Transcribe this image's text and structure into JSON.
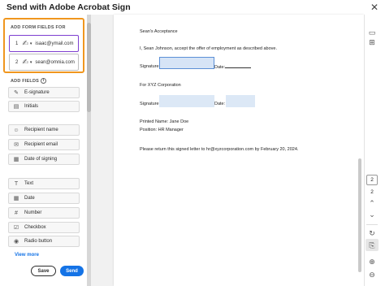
{
  "window": {
    "title": "Send with Adobe Acrobat Sign",
    "close_glyph": "✕"
  },
  "sidebar": {
    "add_form_fields_label": "ADD FORM FIELDS FOR",
    "add_fields_label": "ADD FIELDS",
    "signers": [
      {
        "num": "1",
        "email": "isaac@ymail.com",
        "active": true
      },
      {
        "num": "2",
        "email": "sean@omnia.com",
        "active": false
      }
    ],
    "field_groups": [
      [
        "E-signature",
        "Initials"
      ],
      [
        "Recipient name",
        "Recipient email",
        "Date of signing"
      ],
      [
        "Text",
        "Date",
        "Number",
        "Checkbox",
        "Radio button"
      ]
    ],
    "field_icons": [
      "pen-icon",
      "initials-icon",
      "person-icon",
      "email-icon",
      "calendar-icon",
      "text-icon",
      "date-icon",
      "number-icon",
      "checkbox-icon",
      "radio-icon"
    ],
    "view_more": "View more",
    "save_label": "Save",
    "send_label": "Send"
  },
  "document": {
    "heading": "Sean's Acceptance",
    "line1": "I, Sean Johnson, accept the offer of employment as described above.",
    "signature_label": "Signature:",
    "date_label": "Date:",
    "for_company": "For XYZ Corporation",
    "printed_name": "Printed Name: Jane Doe",
    "position": "Position: HR Manager",
    "return_note": "Please return this signed letter to hr@xyzcorporation.com by February 20, 2024."
  },
  "navigation": {
    "current_page": "2",
    "total_pages": "2"
  },
  "colors": {
    "accent": "#1473e6",
    "highlight": "#f0961e",
    "active_signer": "#7e3fd0"
  }
}
